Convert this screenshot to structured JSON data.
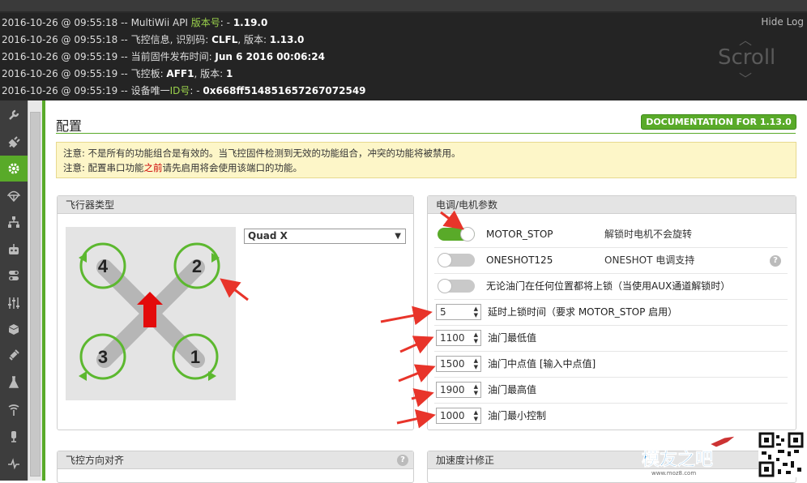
{
  "log": {
    "hide_label": "Hide Log",
    "scroll_label": "Scroll",
    "lines": [
      {
        "time": "2016-10-26 @ 09:55:18 -- ",
        "pre": "MultiWii API ",
        "key": "版本号",
        "sep": ": - ",
        "value": "1.19.0"
      },
      {
        "time": "2016-10-26 @ 09:55:18 -- ",
        "pre": "飞控信息, 识别码: ",
        "key": "",
        "sep": "",
        "value": "CLFL",
        "tail_text": ", 版本: ",
        "tail_value": "1.13.0"
      },
      {
        "time": "2016-10-26 @ 09:55:19 -- ",
        "pre": "当前固件发布时间: ",
        "key": "",
        "sep": "",
        "value": "Jun 6 2016 00:06:24"
      },
      {
        "time": "2016-10-26 @ 09:55:19 -- ",
        "pre": "飞控板: ",
        "key": "",
        "sep": "",
        "value": "AFF1",
        "tail_text": ", 版本: ",
        "tail_value": "1"
      },
      {
        "time": "2016-10-26 @ 09:55:19 -- ",
        "pre": "设备唯一",
        "key": "ID号",
        "sep": ": - ",
        "value": "0x668ff514851657267072549"
      }
    ]
  },
  "sidebar": {
    "items": [
      {
        "icon": "wrench-icon"
      },
      {
        "icon": "plug-icon"
      },
      {
        "icon": "gear-icon",
        "active": true
      },
      {
        "icon": "parachute-icon"
      },
      {
        "icon": "network-icon"
      },
      {
        "icon": "robot-icon"
      },
      {
        "icon": "toggle-icon"
      },
      {
        "icon": "sliders-icon"
      },
      {
        "icon": "cube-icon"
      },
      {
        "icon": "satellite-icon"
      },
      {
        "icon": "flask-icon"
      },
      {
        "icon": "antenna-icon"
      },
      {
        "icon": "motor-icon"
      },
      {
        "icon": "pulse-icon"
      }
    ]
  },
  "page": {
    "title": "配置",
    "doc_button": "DOCUMENTATION FOR 1.13.0",
    "note_line1": "注意: 不是所有的功能组合是有效的。当飞控固件检测到无效的功能组合，冲突的功能将被禁用。",
    "note_line2_pre": "注意: 配置串口功能",
    "note_line2_red": "之前",
    "note_line2_post": "请先启用将会使用该端口的功能。"
  },
  "aircraft": {
    "title": "飞行器类型",
    "selected": "Quad X",
    "motors": [
      "4",
      "2",
      "3",
      "1"
    ]
  },
  "esc": {
    "title": "电调/电机参数",
    "toggles": [
      {
        "label": "MOTOR_STOP",
        "desc": "解锁时电机不会旋转",
        "on": true
      },
      {
        "label": "ONESHOT125",
        "desc": "ONESHOT 电调支持",
        "on": false
      },
      {
        "label": "无论油门在任何位置都将上锁（当使用AUX通道解锁时）",
        "desc": "",
        "on": false
      }
    ],
    "numbers": [
      {
        "value": "5",
        "label": "延时上锁时间（要求 MOTOR_STOP 启用）"
      },
      {
        "value": "1100",
        "label": "油门最低值"
      },
      {
        "value": "1500",
        "label": "油门中点值 [输入中点值]"
      },
      {
        "value": "1900",
        "label": "油门最高值"
      },
      {
        "value": "1000",
        "label": "油门最小控制"
      }
    ]
  },
  "align": {
    "title": "飞控方向对齐"
  },
  "acc": {
    "title": "加速度计修正"
  },
  "help_glyph": "?",
  "watermark": {
    "brand": "模友之吧",
    "url": "www.moz8.com"
  },
  "colors": {
    "accent": "#59aa29",
    "arrow": "#e8342a",
    "log_bg": "#242424",
    "sidebar_bg": "#3d3d3d"
  }
}
